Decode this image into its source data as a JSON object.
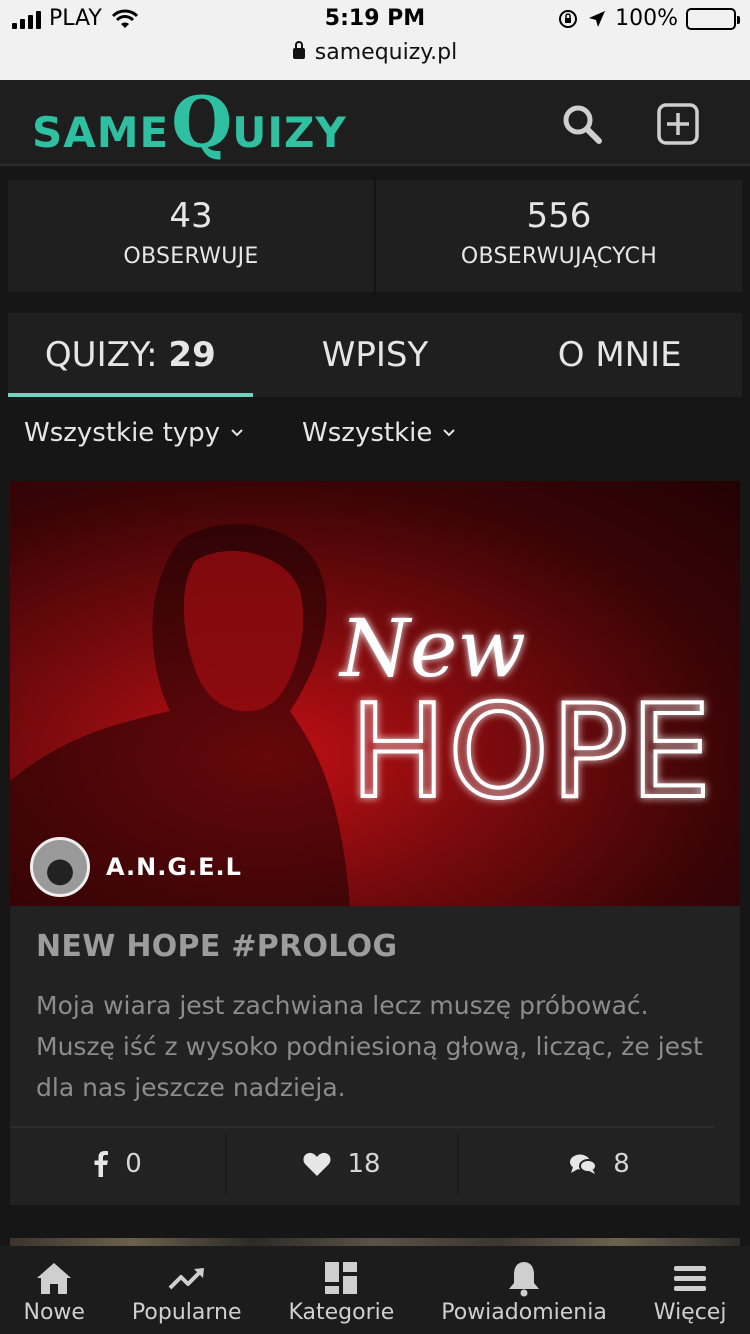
{
  "status_bar": {
    "carrier": "PLAY",
    "time": "5:19 PM",
    "battery": "100%",
    "url": "samequizy.pl"
  },
  "header": {
    "logo_same": "same",
    "logo_q": "Q",
    "logo_rest": "uizy",
    "icons": [
      "search-icon",
      "add-square-icon"
    ]
  },
  "stats": {
    "following_count": "43",
    "following_label": "OBSERWUJE",
    "followers_count": "556",
    "followers_label": "OBSERWUJĄCYCH"
  },
  "tabs": {
    "quizzes_label": "QUIZY: ",
    "quizzes_count": "29",
    "posts_label": "WPISY",
    "about_label": "O MNIE",
    "active": "quizzes"
  },
  "filters": {
    "type": "Wszystkie typy",
    "scope": "Wszystkie"
  },
  "quiz_card": {
    "hero_script": "New",
    "hero_big": "HOPE",
    "author": "A.N.G.E.L",
    "title": "NEW HOPE #PROLOG",
    "description": "Moja wiara jest zachwiana lecz muszę próbować. Muszę iść z wysoko podniesioną głową, licząc, że jest dla nas jeszcze nadzieja.",
    "shares": "0",
    "likes": "18",
    "comments": "8"
  },
  "bottom_nav": {
    "items": [
      {
        "label": "Nowe",
        "icon": "home-icon"
      },
      {
        "label": "Popularne",
        "icon": "trending-icon"
      },
      {
        "label": "Kategorie",
        "icon": "grid-icon"
      },
      {
        "label": "Powiadomienia",
        "icon": "bell-icon"
      },
      {
        "label": "Więcej",
        "icon": "menu-icon"
      }
    ]
  },
  "colors": {
    "accent": "#2fc0a1",
    "tab_underline": "#6fd3be",
    "background": "#161616",
    "card": "#222222"
  }
}
